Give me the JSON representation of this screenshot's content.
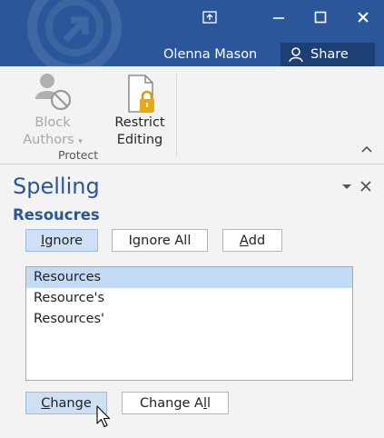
{
  "titlebar": {
    "username": "Olenna Mason",
    "share_label": "Share",
    "icons": [
      "ribbon-display-options-icon",
      "minimize-icon",
      "maximize-icon",
      "close-icon"
    ]
  },
  "ribbon": {
    "group_label": "Protect",
    "block_authors": {
      "line1": "Block",
      "line2": "Authors",
      "enabled": false
    },
    "restrict_editing": {
      "line1": "Restrict",
      "line2": "Editing",
      "enabled": true
    }
  },
  "spelling": {
    "title": "Spelling",
    "misspelled_word": "Resoucres",
    "ignore": {
      "pre": "",
      "key": "I",
      "post": "gnore"
    },
    "ignore_all": {
      "pre": "I",
      "key": "g",
      "post": "nore All"
    },
    "add": {
      "pre": "",
      "key": "A",
      "post": "dd"
    },
    "suggestions": [
      "Resources",
      "Resource's",
      "Resources'"
    ],
    "selected_index": 0,
    "change": {
      "pre": "",
      "key": "C",
      "post": "hange"
    },
    "change_all": {
      "pre": "Change A",
      "key": "l",
      "post": "l"
    }
  },
  "colors": {
    "titlebar": "#2b579a",
    "share_bg": "#1e3f74",
    "accent_text": "#2b579a",
    "selected_row": "#c4dbf5"
  }
}
